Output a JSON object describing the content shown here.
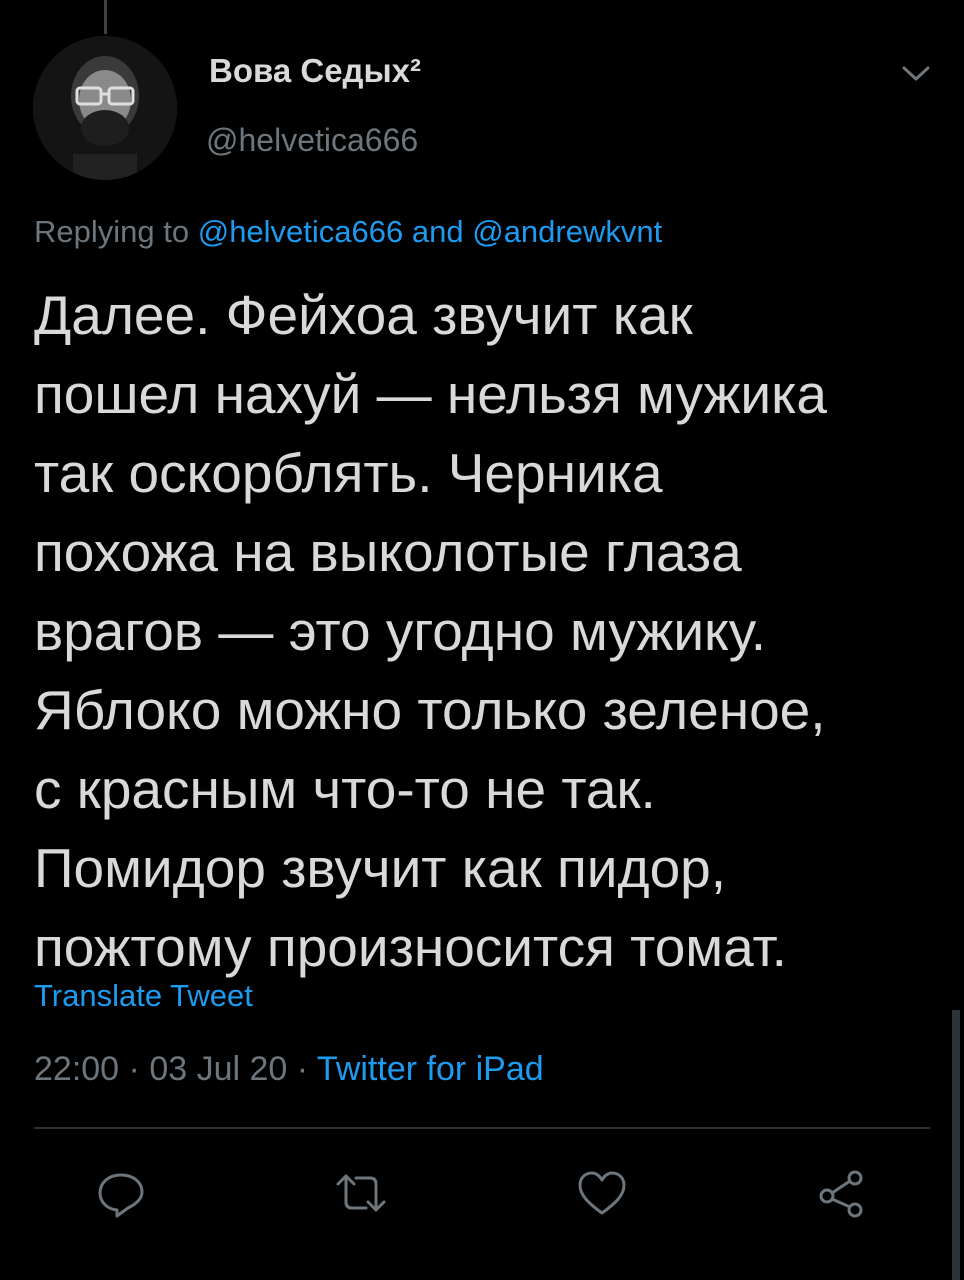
{
  "author": {
    "display_name": "Вова Седых²",
    "handle": "@helvetica666"
  },
  "reply": {
    "prefix": "Replying to ",
    "mention_1": "@helvetica666",
    "joiner": " and ",
    "mention_2": "@andrewkvnt"
  },
  "tweet": {
    "lines": [
      "Далее. Фейхоа звучит как",
      "пошел нахуй — нельзя мужика",
      "так оскорблять. Черника",
      "похожа на выколотые глаза",
      "врагов — это угодно мужику.",
      "Яблоко можно только зеленое,",
      "с красным что-то не так.",
      "Помидор звучит как пидор,",
      "пожтому произносится томат."
    ]
  },
  "translate_label": "Translate Tweet",
  "meta": {
    "time": "22:00",
    "separator": " · ",
    "date": "03 Jul 20",
    "source": "Twitter for iPad"
  },
  "icons": {
    "menu": "chevron-down-icon",
    "reply": "reply-icon",
    "retweet": "retweet-icon",
    "like": "heart-icon",
    "share": "share-icon"
  },
  "colors": {
    "background": "#000000",
    "text": "#d9d9d9",
    "secondary": "#6e767d",
    "link": "#1d9bf0",
    "divider": "#2f3336"
  }
}
